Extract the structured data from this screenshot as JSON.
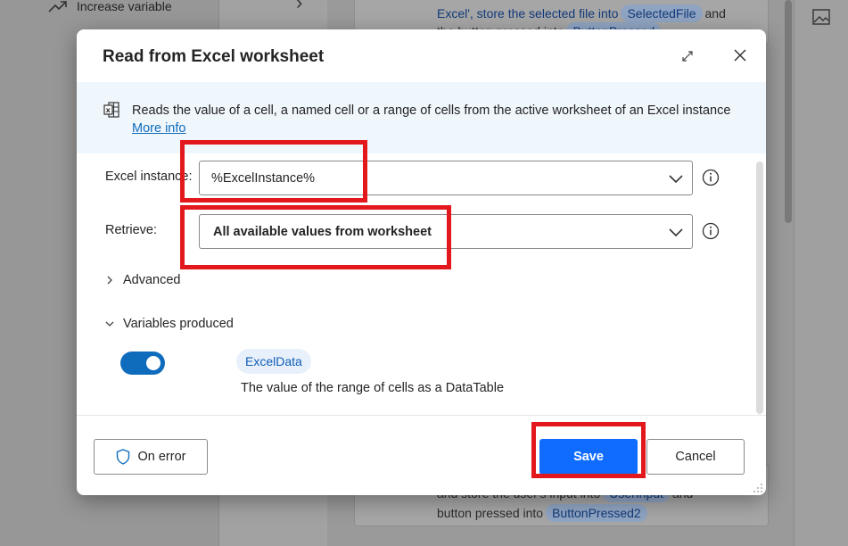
{
  "background": {
    "left_item": "Increase variable",
    "card_top_line1": [
      "Excel', store the selected file into",
      "SelectedFile",
      "and"
    ],
    "card_top_line2": [
      "the button pressed into",
      "ButtonPressed"
    ],
    "card_bottom_line1": [
      "and store the user's input into",
      "UserInput",
      "and"
    ],
    "card_bottom_line2": [
      "button pressed into",
      "ButtonPressed2"
    ]
  },
  "dialog": {
    "title": "Read from Excel worksheet",
    "info_text": "Reads the value of a cell, a named cell or a range of cells from the active worksheet of an Excel instance",
    "more_info": "More info",
    "fields": {
      "excel_instance": {
        "label": "Excel instance:",
        "value": "%ExcelInstance%"
      },
      "retrieve": {
        "label": "Retrieve:",
        "value": "All available values from worksheet"
      }
    },
    "advanced_label": "Advanced",
    "variables_label": "Variables produced",
    "variable": {
      "name": "ExcelData",
      "description": "The value of the range of cells as a DataTable",
      "enabled": true
    },
    "buttons": {
      "on_error": "On error",
      "save": "Save",
      "cancel": "Cancel"
    }
  },
  "colors": {
    "accent": "#0f6cbd",
    "save_button": "#0f6cff",
    "highlight": "#e3181c",
    "info_banner": "#eff6fc"
  }
}
